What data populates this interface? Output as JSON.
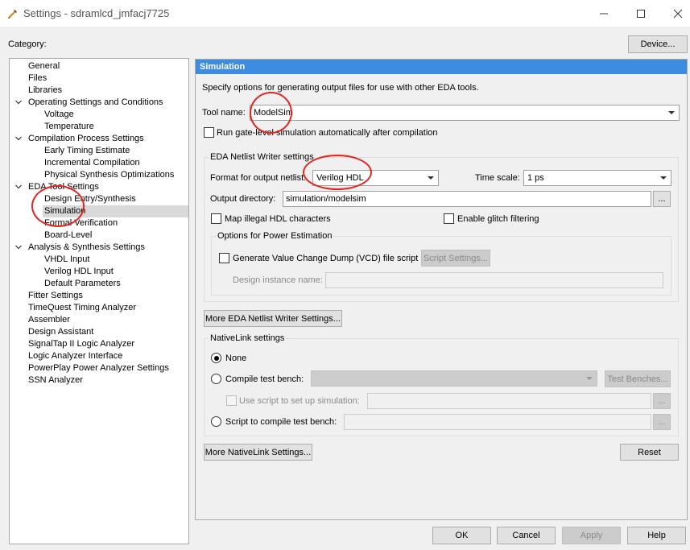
{
  "window": {
    "title": "Settings - sdramlcd_jmfacj7725",
    "icon": "wrench-pencil-icon"
  },
  "category_label": "Category:",
  "device_button": "Device...",
  "tree": [
    {
      "label": "General",
      "level": 0,
      "expand": false
    },
    {
      "label": "Files",
      "level": 0,
      "expand": false
    },
    {
      "label": "Libraries",
      "level": 0,
      "expand": false
    },
    {
      "label": "Operating Settings and Conditions",
      "level": 0,
      "expand": true
    },
    {
      "label": "Voltage",
      "level": 1,
      "expand": false
    },
    {
      "label": "Temperature",
      "level": 1,
      "expand": false
    },
    {
      "label": "Compilation Process Settings",
      "level": 0,
      "expand": true
    },
    {
      "label": "Early Timing Estimate",
      "level": 1,
      "expand": false
    },
    {
      "label": "Incremental Compilation",
      "level": 1,
      "expand": false
    },
    {
      "label": "Physical Synthesis Optimizations",
      "level": 1,
      "expand": false
    },
    {
      "label": "EDA Tool Settings",
      "level": 0,
      "expand": true
    },
    {
      "label": "Design Entry/Synthesis",
      "level": 1,
      "expand": false
    },
    {
      "label": "Simulation",
      "level": 1,
      "expand": false,
      "selected": true
    },
    {
      "label": "Formal Verification",
      "level": 1,
      "expand": false
    },
    {
      "label": "Board-Level",
      "level": 1,
      "expand": false
    },
    {
      "label": "Analysis & Synthesis Settings",
      "level": 0,
      "expand": true
    },
    {
      "label": "VHDL Input",
      "level": 1,
      "expand": false
    },
    {
      "label": "Verilog HDL Input",
      "level": 1,
      "expand": false
    },
    {
      "label": "Default Parameters",
      "level": 1,
      "expand": false
    },
    {
      "label": "Fitter Settings",
      "level": 0,
      "expand": false
    },
    {
      "label": "TimeQuest Timing Analyzer",
      "level": 0,
      "expand": false
    },
    {
      "label": "Assembler",
      "level": 0,
      "expand": false
    },
    {
      "label": "Design Assistant",
      "level": 0,
      "expand": false
    },
    {
      "label": "SignalTap II Logic Analyzer",
      "level": 0,
      "expand": false
    },
    {
      "label": "Logic Analyzer Interface",
      "level": 0,
      "expand": false
    },
    {
      "label": "PowerPlay Power Analyzer Settings",
      "level": 0,
      "expand": false
    },
    {
      "label": "SSN Analyzer",
      "level": 0,
      "expand": false
    }
  ],
  "panel": {
    "header": "Simulation",
    "description": "Specify options for generating output files for use with other EDA tools.",
    "tool_name_label": "Tool name:",
    "tool_name_value": "ModelSim",
    "run_gate_level_label": "Run gate-level simulation automatically after compilation",
    "run_gate_level_checked": false,
    "netlist": {
      "group_label": "EDA Netlist Writer settings",
      "format_label": "Format for output netlist:",
      "format_value": "Verilog HDL",
      "timescale_label": "Time scale:",
      "timescale_value": "1 ps",
      "outdir_label": "Output directory:",
      "outdir_value": "simulation/modelsim",
      "outdir_browse": "...",
      "map_illegal_label": "Map illegal HDL characters",
      "map_illegal_checked": false,
      "glitch_label": "Enable glitch filtering",
      "glitch_checked": false,
      "power_group_label": "Options for Power Estimation",
      "vcd_label": "Generate Value Change Dump (VCD) file script",
      "vcd_checked": false,
      "script_settings_button": "Script Settings...",
      "design_instance_label": "Design instance name:",
      "design_instance_value": ""
    },
    "more_netlist_button": "More EDA Netlist Writer Settings...",
    "nativelink": {
      "group_label": "NativeLink settings",
      "none_label": "None",
      "compile_tb_label": "Compile test bench:",
      "compile_tb_value": "",
      "test_benches_button": "Test Benches...",
      "use_script_label": "Use script to set up simulation:",
      "use_script_value": "",
      "script_compile_label": "Script to compile test bench:",
      "script_compile_value": "",
      "browse": "...",
      "selected": "None"
    },
    "more_nativelink_button": "More NativeLink Settings...",
    "reset_button": "Reset"
  },
  "footer": {
    "ok": "OK",
    "cancel": "Cancel",
    "apply": "Apply",
    "help": "Help"
  },
  "colors": {
    "header_bg": "#3c8ce0",
    "selection_bg": "#d9d9d9",
    "annotation": "#e0261e"
  }
}
